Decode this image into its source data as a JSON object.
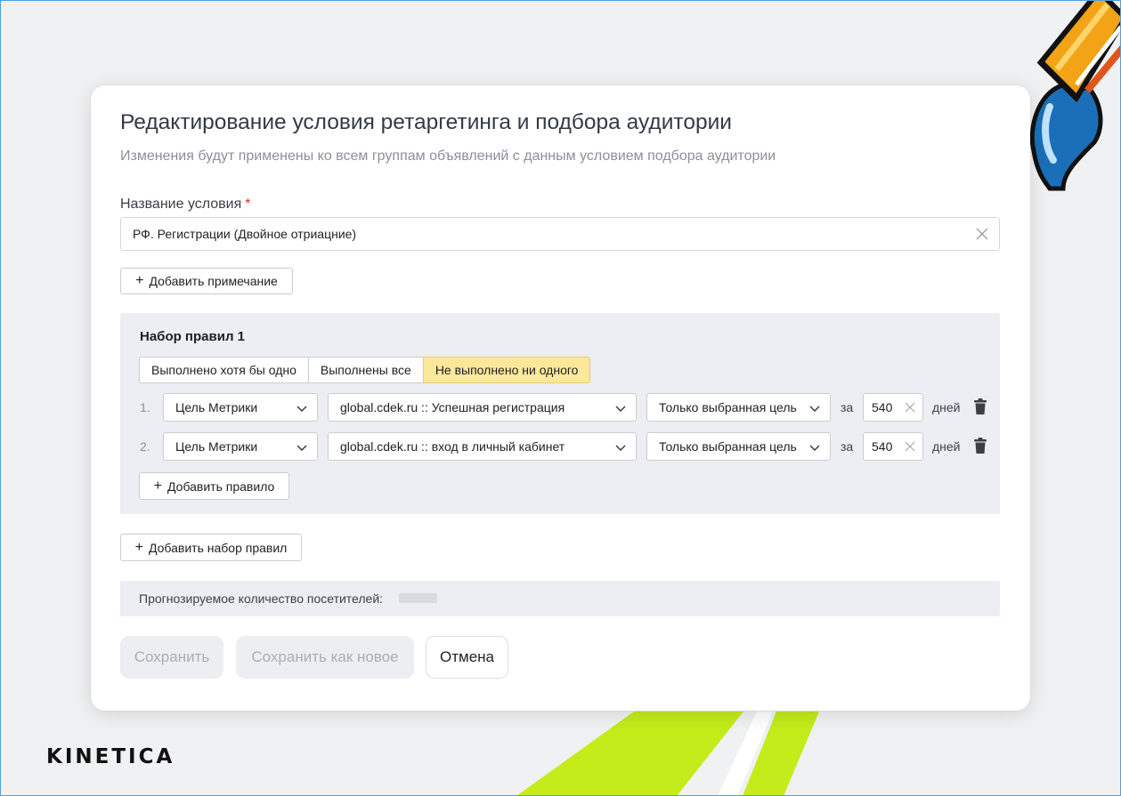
{
  "brand": {
    "logo_text": "KINETICA"
  },
  "dialog": {
    "title": "Редактирование условия ретаргетинга и подбора аудитории",
    "subtitle": "Изменения будут применены ко всем группам объявлений с данным условием подбора аудитории",
    "name_field": {
      "label": "Название условия",
      "required_mark": "*",
      "value": "РФ. Регистрации (Двойное отриацние)"
    },
    "add_note_button": "Добавить примечание",
    "rulesets": [
      {
        "title": "Набор правил 1",
        "modes": [
          "Выполнено хотя бы одно",
          "Выполнены все",
          "Не выполнено ни одного"
        ],
        "active_mode": "Не выполнено ни одного",
        "rules": [
          {
            "number": "1.",
            "type": "Цель Метрики",
            "goal": "global.cdek.ru :: Успешная регистрация",
            "scope": "Только выбранная цель",
            "za": "за",
            "days": "540",
            "days_unit": "дней"
          },
          {
            "number": "2.",
            "type": "Цель Метрики",
            "goal": "global.cdek.ru :: вход в личный кабинет",
            "scope": "Только выбранная цель",
            "za": "за",
            "days": "540",
            "days_unit": "дней"
          }
        ],
        "add_rule_button": "Добавить правило"
      }
    ],
    "add_ruleset_button": "Добавить набор правил",
    "forecast_label": "Прогнозируемое количество посетителей:",
    "buttons": {
      "save": "Сохранить",
      "save_as_new": "Сохранить как новое",
      "cancel": "Отмена"
    }
  },
  "colors": {
    "active_segment": "#fce89a",
    "panel_bg": "#eceef4",
    "required": "#e3321a"
  }
}
